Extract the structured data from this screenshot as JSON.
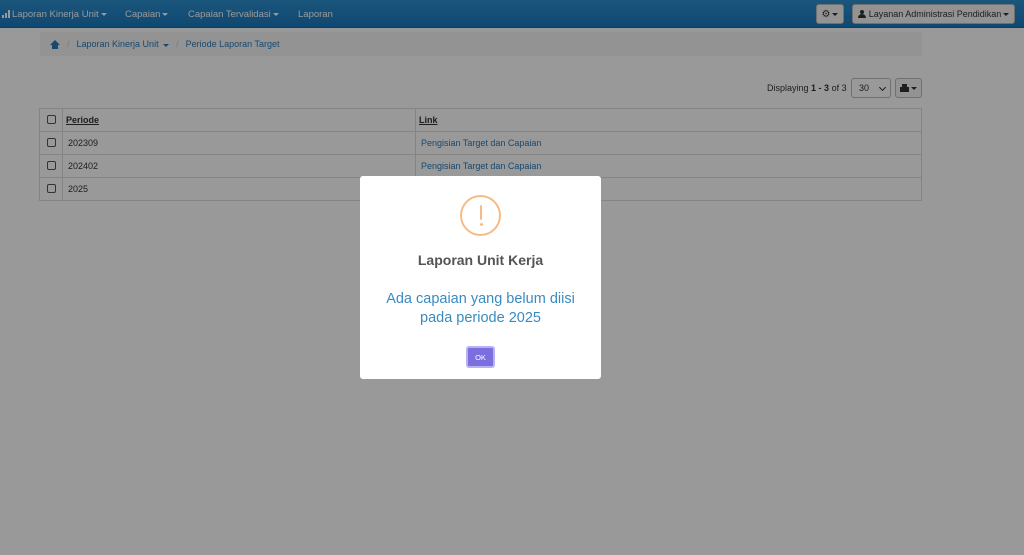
{
  "navbar": {
    "brand": "Laporan Kinerja Unit",
    "items": [
      "Capaian",
      "Capaian Tervalidasi",
      "Laporan"
    ],
    "user_label": "Layanan Administrasi Pendidikan"
  },
  "breadcrumb": {
    "items": [
      "Laporan Kinerja Unit",
      "Periode Laporan Target"
    ]
  },
  "pager": {
    "prefix": "Displaying",
    "range": "1 - 3",
    "of_text": "of",
    "total": "3",
    "page_size": "30"
  },
  "table": {
    "headers": [
      "Periode",
      "Link"
    ],
    "rows": [
      {
        "periode": "202309",
        "link": "Pengisian Target dan Capaian"
      },
      {
        "periode": "202402",
        "link": "Pengisian Target dan Capaian"
      },
      {
        "periode": "2025",
        "link": ""
      }
    ]
  },
  "modal": {
    "title": "Laporan Unit Kerja",
    "message": "Ada capaian yang belum diisi pada periode 2025",
    "ok_label": "OK"
  },
  "colors": {
    "navbar": "#1f82c4",
    "link": "#2a7ab8",
    "warning": "#f8bb86",
    "ok_button": "#7b6fe0",
    "message": "#3a8bc0"
  }
}
